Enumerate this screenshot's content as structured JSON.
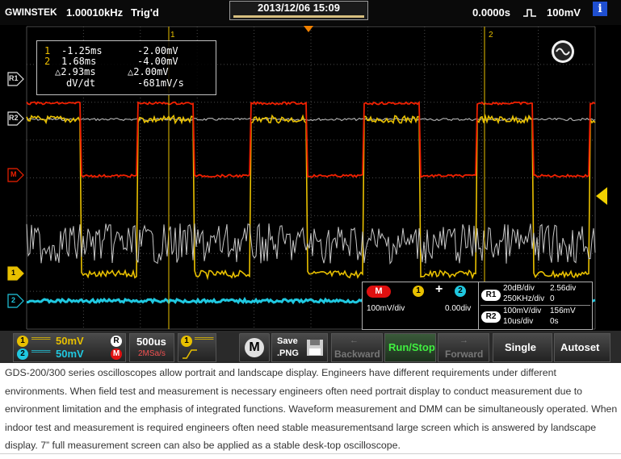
{
  "header": {
    "brand": "GWINSTEK",
    "frequency": "1.00010kHz",
    "trigger_status": "Trig'd",
    "datetime": "2013/12/06  15:09",
    "time_offset": "0.0000s",
    "trigger_level": "100mV",
    "trigger_edge_icon": "rising-edge-icon",
    "info_label": "i"
  },
  "cursor_readout": {
    "row1": {
      "id": "1",
      "time": "-1.25ms",
      "volt": "-2.00mV"
    },
    "row2": {
      "id": "2",
      "time": "1.68ms",
      "volt": "-4.00mV"
    },
    "row3": {
      "time": "△2.93ms",
      "volt": "△2.00mV"
    },
    "row4": {
      "label": "dV/dt",
      "value": "-681mV/s"
    }
  },
  "grid_labels": {
    "cursor1": "1",
    "cursor2": "2"
  },
  "left_markers": {
    "r1": "R1",
    "r2": "R2",
    "math": "M",
    "ch1": "1",
    "ch2": "2"
  },
  "math_panel": {
    "badge": "M",
    "expr_a": "1",
    "operator": "+",
    "expr_b": "2",
    "scale": "100mV/div",
    "offset": "0.00div"
  },
  "ref_panel": {
    "r1": {
      "badge": "R1",
      "vdiv": "20dB/div",
      "pos": "2.56div",
      "hdiv": "250KHz/div",
      "hpos": "0"
    },
    "r2": {
      "badge": "R2",
      "vdiv": "100mV/div",
      "pos": "156mV",
      "hdiv": "10us/div",
      "hpos": "0s"
    }
  },
  "softkeys": {
    "ch1_scale": "50mV",
    "ch2_scale": "50mV",
    "r_badge": "R",
    "m_badge": "M",
    "timebase": "500us",
    "sample_rate": "2MSa/s",
    "trigger_ch": "1",
    "math_button": "M",
    "save_label": "Save",
    "save_format": ".PNG",
    "backward": "Backward",
    "run_stop": "Run/Stop",
    "forward": "Forward",
    "single": "Single",
    "autoset": "Autoset"
  },
  "colors": {
    "ch1": "#e8c000",
    "ch2": "#20c8e0",
    "math": "#f02000",
    "ref": "#c8c8c8",
    "grid": "#4a4a4a"
  },
  "caption": "GDS-200/300 series oscilloscopes allow portrait and landscape display. Engineers have different requirements under different environments. When field test and measurement is necessary engineers often need portrait display to conduct measurement due to environment limitation and the emphasis of integrated functions. Waveform measurement and DMM can be simultaneously operated. When indoor test and measurement is required engineers often need stable measurementsand large screen which is answered by landscape display. 7” full measurement screen can also be applied as a stable desk-top oscilloscope."
}
